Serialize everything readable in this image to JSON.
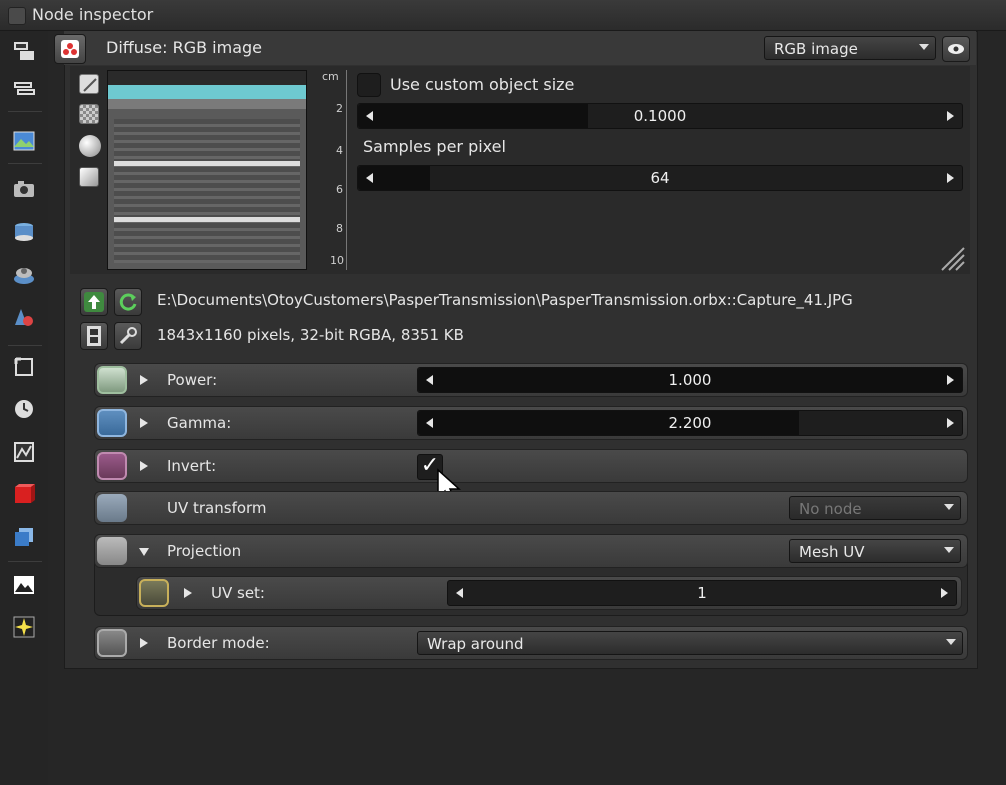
{
  "window": {
    "title": "Node inspector"
  },
  "header": {
    "node_label": "Diffuse: RGB image",
    "type_dropdown": "RGB image"
  },
  "ruler": {
    "unit": "cm",
    "ticks": [
      "2",
      "4",
      "6",
      "8",
      "10"
    ]
  },
  "object_size": {
    "checkbox_label": "Use custom object size",
    "value": "0.1000",
    "fill_fraction": 0.38
  },
  "samples": {
    "label": "Samples per pixel",
    "value": "64",
    "fill_fraction": 0.12
  },
  "file": {
    "path": "E:\\Documents\\OtoyCustomers\\PasperTransmission\\PasperTransmission.orbx::Capture_41.JPG",
    "info": "1843x1160 pixels, 32-bit RGBA, 8351 KB"
  },
  "params": {
    "power": {
      "label": "Power:",
      "value": "1.000",
      "fill_fraction": 1.0
    },
    "gamma": {
      "label": "Gamma:",
      "value": "2.200",
      "fill_fraction": 0.7
    },
    "invert": {
      "label": "Invert:",
      "checked": "✓"
    },
    "uv_transform": {
      "label": "UV transform",
      "dropdown": "No node"
    },
    "projection": {
      "label": "Projection",
      "dropdown": "Mesh UV"
    },
    "uv_set": {
      "label": "UV set:",
      "value": "1",
      "fill_fraction": 0.0
    },
    "border_mode": {
      "label": "Border mode:",
      "dropdown": "Wrap around"
    }
  },
  "colors": {
    "accent_green": "#3f8a3f",
    "panel_bg": "#303030",
    "slider_bg": "#1e1e1e"
  },
  "icons": {
    "left_toolbar": [
      "nodes-icon",
      "graph-icon",
      "image-icon",
      "camera-icon",
      "database-icon",
      "material-icon",
      "shapes-icon",
      "crop-icon",
      "clock-icon",
      "texture-icon",
      "red-cube-icon",
      "blue-layers-icon",
      "picture-icon",
      "sparkle-icon"
    ]
  }
}
